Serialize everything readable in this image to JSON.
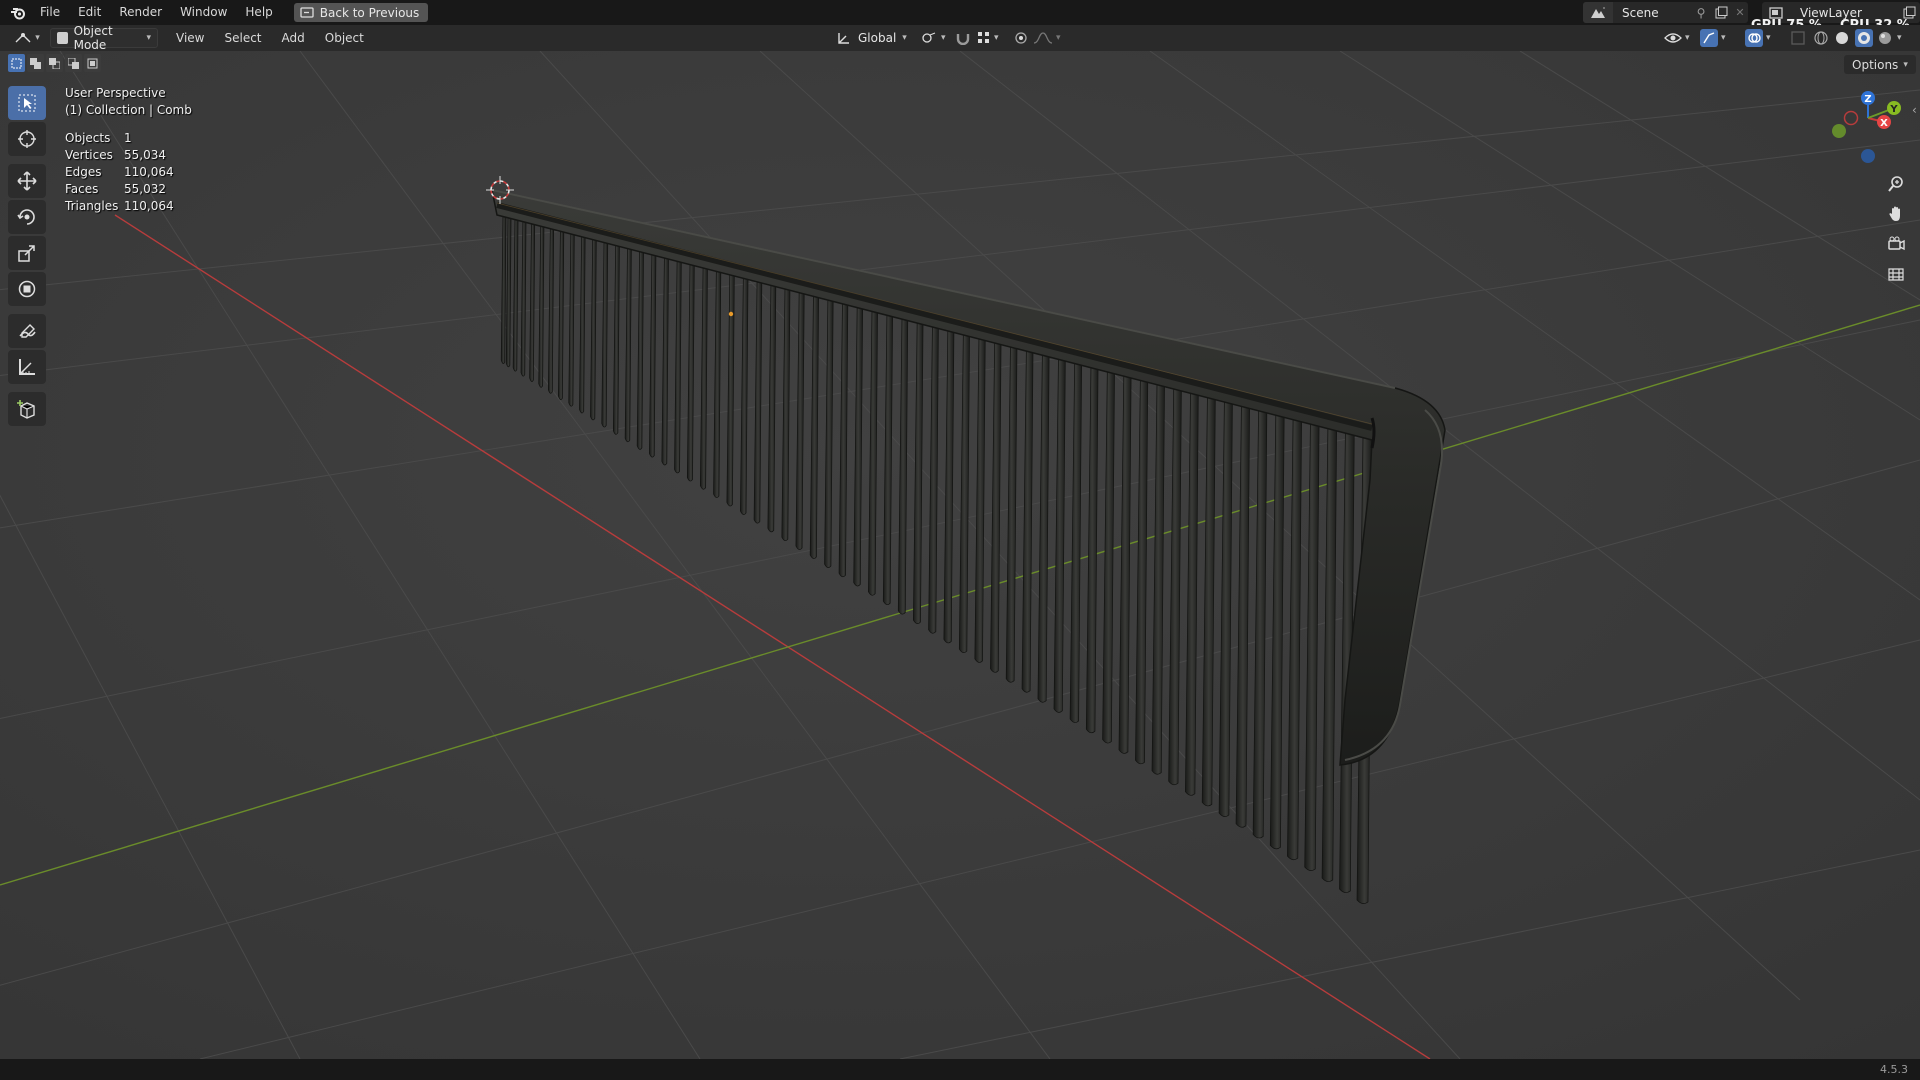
{
  "topbar": {
    "menus": [
      "File",
      "Edit",
      "Render",
      "Window",
      "Help"
    ],
    "back_button": "Back to Previous",
    "scene_name": "Scene",
    "view_layer": "ViewLayer",
    "gpu_label": "GPU",
    "gpu_value": "75 %",
    "cpu_label": "CPU",
    "cpu_value": "32 %"
  },
  "header": {
    "mode": "Object Mode",
    "menus": [
      "View",
      "Select",
      "Add",
      "Object"
    ],
    "orientation": "Global",
    "options": "Options"
  },
  "viewport": {
    "view_name": "User Perspective",
    "collection": "(1) Collection | Comb",
    "stats": [
      {
        "label": "Objects",
        "value": "1"
      },
      {
        "label": "Vertices",
        "value": "55,034"
      },
      {
        "label": "Edges",
        "value": "110,064"
      },
      {
        "label": "Faces",
        "value": "55,032"
      },
      {
        "label": "Triangles",
        "value": "110,064"
      }
    ],
    "gizmo_axes": {
      "x": "X",
      "y": "Y",
      "z": "Z"
    }
  },
  "colors": {
    "accent": "#4772b3",
    "x_axis": "#c63b3b",
    "y_axis": "#6c9a2a",
    "z_axis": "#2f73d6"
  },
  "statusbar": {
    "version": "4.5.3"
  }
}
